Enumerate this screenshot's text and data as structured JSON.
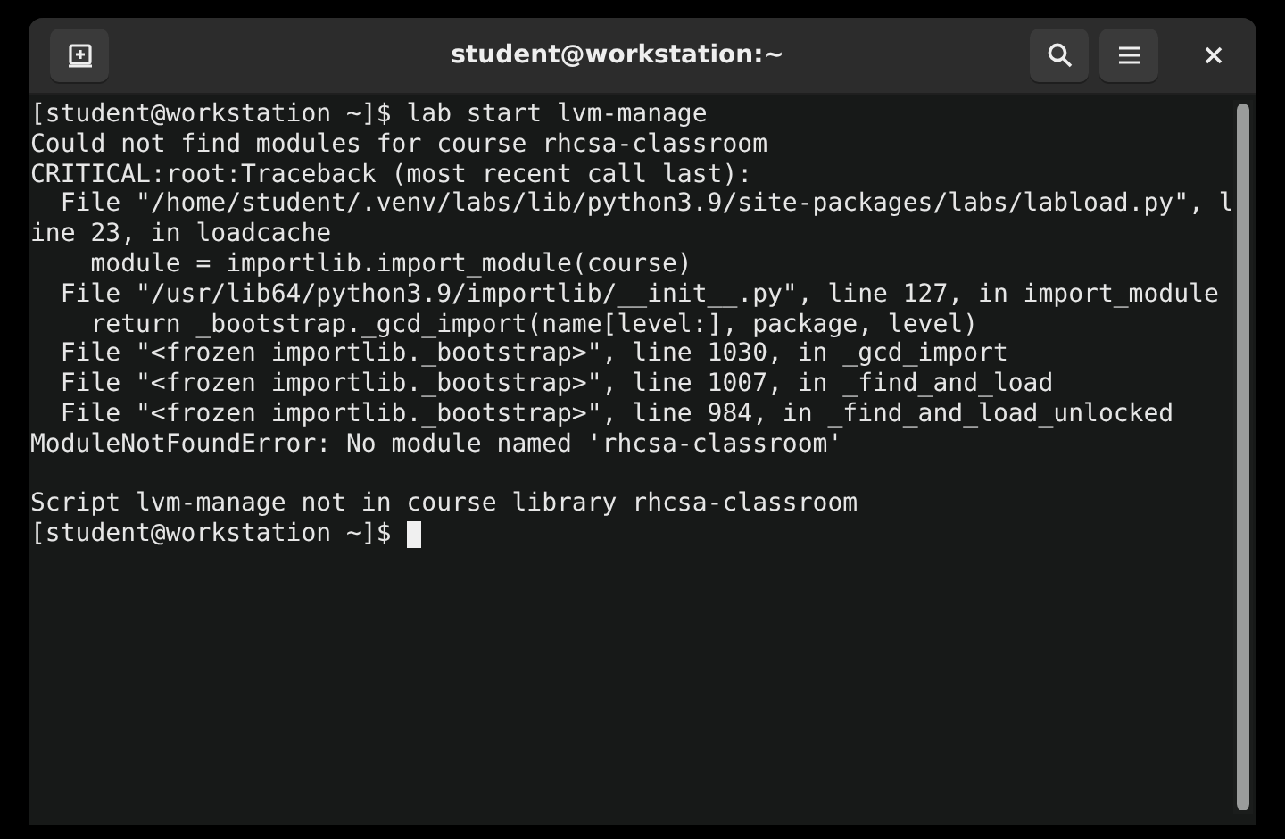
{
  "window": {
    "title": "student@workstation:~"
  },
  "terminal": {
    "blocks": [
      [
        "[student@workstation ~]$ lab start lvm-manage",
        "Could not find modules for course rhcsa-classroom",
        "CRITICAL:root:Traceback (most recent call last):",
        "  File \"/home/student/.venv/labs/lib/python3.9/site-packages/labs/labload.py\", l",
        "ine 23, in loadcache",
        "    module = importlib.import_module(course)",
        "  File \"/usr/lib64/python3.9/importlib/__init__.py\", line 127, in import_module",
        "    return _bootstrap._gcd_import(name[level:], package, level)",
        "  File \"<frozen importlib._bootstrap>\", line 1030, in _gcd_import",
        "  File \"<frozen importlib._bootstrap>\", line 1007, in _find_and_load",
        "  File \"<frozen importlib._bootstrap>\", line 984, in _find_and_load_unlocked",
        "ModuleNotFoundError: No module named 'rhcsa-classroom'"
      ],
      [
        "Script lvm-manage not in course library rhcsa-classroom"
      ]
    ],
    "prompt": {
      "text": "[student@workstation ~]$",
      "cursor": true
    }
  }
}
